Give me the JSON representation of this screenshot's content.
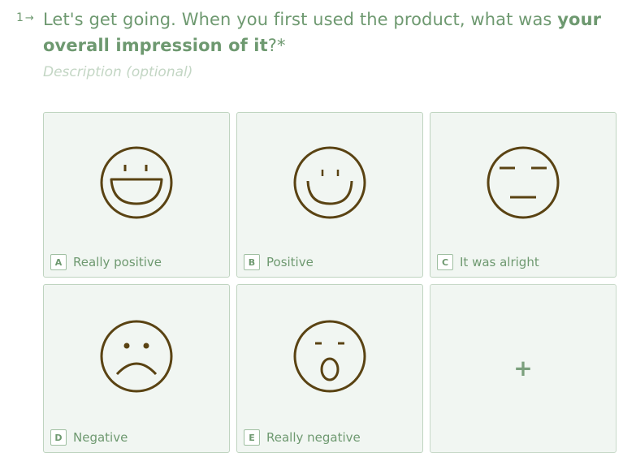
{
  "question": {
    "number": "1",
    "arrow_icon": "arrow-right-icon",
    "text_plain": "Let's get going. When you first used the product, what was ",
    "text_bold": "your overall impression of it",
    "text_suffix": "?*",
    "description_placeholder": "Description (optional)"
  },
  "choices": [
    {
      "key": "A",
      "label": "Really positive",
      "icon": "big-smile-face-icon"
    },
    {
      "key": "B",
      "label": "Positive",
      "icon": "smile-face-icon"
    },
    {
      "key": "C",
      "label": "It was alright",
      "icon": "neutral-face-icon"
    },
    {
      "key": "D",
      "label": "Negative",
      "icon": "sad-face-icon"
    },
    {
      "key": "E",
      "label": "Really negative",
      "icon": "shocked-face-icon"
    }
  ],
  "add_choice": {
    "symbol": "+"
  },
  "colors": {
    "accent": "#6e9970",
    "card_bg": "#f1f6f2",
    "card_border": "#bfd4c0",
    "icon_stroke": "#5a4313",
    "placeholder": "#c3d6c4"
  }
}
